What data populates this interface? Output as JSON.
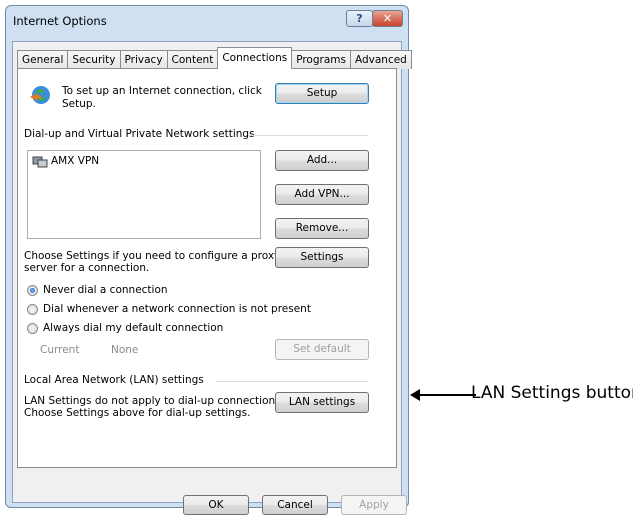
{
  "window": {
    "title": "Internet Options",
    "help_label": "?",
    "close_label": "✕"
  },
  "tabs": [
    {
      "label": "General"
    },
    {
      "label": "Security"
    },
    {
      "label": "Privacy"
    },
    {
      "label": "Content"
    },
    {
      "label": "Connections"
    },
    {
      "label": "Programs"
    },
    {
      "label": "Advanced"
    }
  ],
  "setup": {
    "text_line1": "To set up an Internet connection, click",
    "text_line2": "Setup.",
    "button": "Setup"
  },
  "vpn": {
    "section_label": "Dial-up and Virtual Private Network settings",
    "items": [
      {
        "label": "AMX VPN"
      }
    ],
    "add_button": "Add...",
    "add_vpn_button": "Add VPN...",
    "remove_button": "Remove...",
    "proxy_text_line1": "Choose Settings if you need to configure a proxy",
    "proxy_text_line2": "server for a connection.",
    "settings_button": "Settings"
  },
  "dial_options": [
    {
      "label": "Never dial a connection",
      "selected": true
    },
    {
      "label": "Dial whenever a network connection is not present",
      "selected": false
    },
    {
      "label": "Always dial my default connection",
      "selected": false
    }
  ],
  "current": {
    "label": "Current",
    "value": "None",
    "set_default_button": "Set default"
  },
  "lan": {
    "section_label": "Local Area Network (LAN) settings",
    "text_line1": "LAN Settings do not apply to dial-up connections.",
    "text_line2": "Choose Settings above for dial-up settings.",
    "button": "LAN settings"
  },
  "footer": {
    "ok": "OK",
    "cancel": "Cancel",
    "apply": "Apply"
  },
  "annotation": {
    "label": "LAN Settings button"
  }
}
